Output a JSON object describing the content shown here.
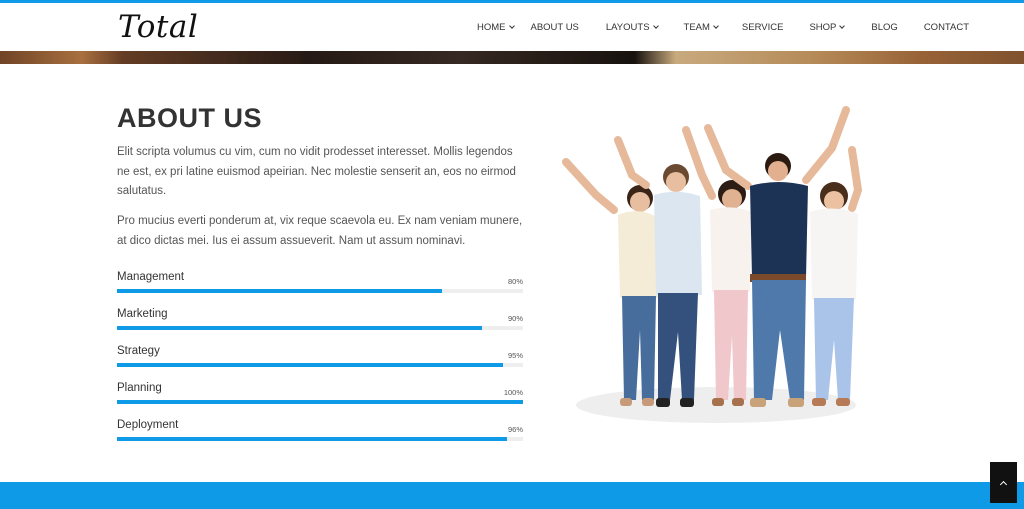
{
  "brand": {
    "logo_text": "Total",
    "accent_color": "#0f9ae8"
  },
  "nav": {
    "items": [
      {
        "label": "HOME",
        "dropdown": true
      },
      {
        "label": "ABOUT US",
        "dropdown": false
      },
      {
        "label": "LAYOUTS",
        "dropdown": true
      },
      {
        "label": "TEAM",
        "dropdown": true
      },
      {
        "label": "SERVICE",
        "dropdown": false
      },
      {
        "label": "SHOP",
        "dropdown": true
      },
      {
        "label": "BLOG",
        "dropdown": false
      },
      {
        "label": "CONTACT",
        "dropdown": false
      }
    ]
  },
  "about": {
    "title": "ABOUT US",
    "paragraph1": "Elit scripta volumus cu vim, cum no vidit prodesset interesset. Mollis legendos ne est, ex pri latine euismod apeirian. Nec molestie senserit an, eos no eirmod salutatus.",
    "paragraph2": "Pro mucius everti ponderum at, vix reque scaevola eu. Ex nam veniam munere, at dico dictas mei. Ius ei assum assueverit. Nam ut assum nominavi."
  },
  "skills": [
    {
      "label": "Management",
      "percent_text": "80%",
      "value": 80
    },
    {
      "label": "Marketing",
      "percent_text": "90%",
      "value": 90
    },
    {
      "label": "Strategy",
      "percent_text": "95%",
      "value": 95
    },
    {
      "label": "Planning",
      "percent_text": "100%",
      "value": 100
    },
    {
      "label": "Deployment",
      "percent_text": "96%",
      "value": 96
    }
  ],
  "icons": {
    "scroll_top": "chevron-up-icon",
    "nav_dropdown": "chevron-down-icon"
  }
}
